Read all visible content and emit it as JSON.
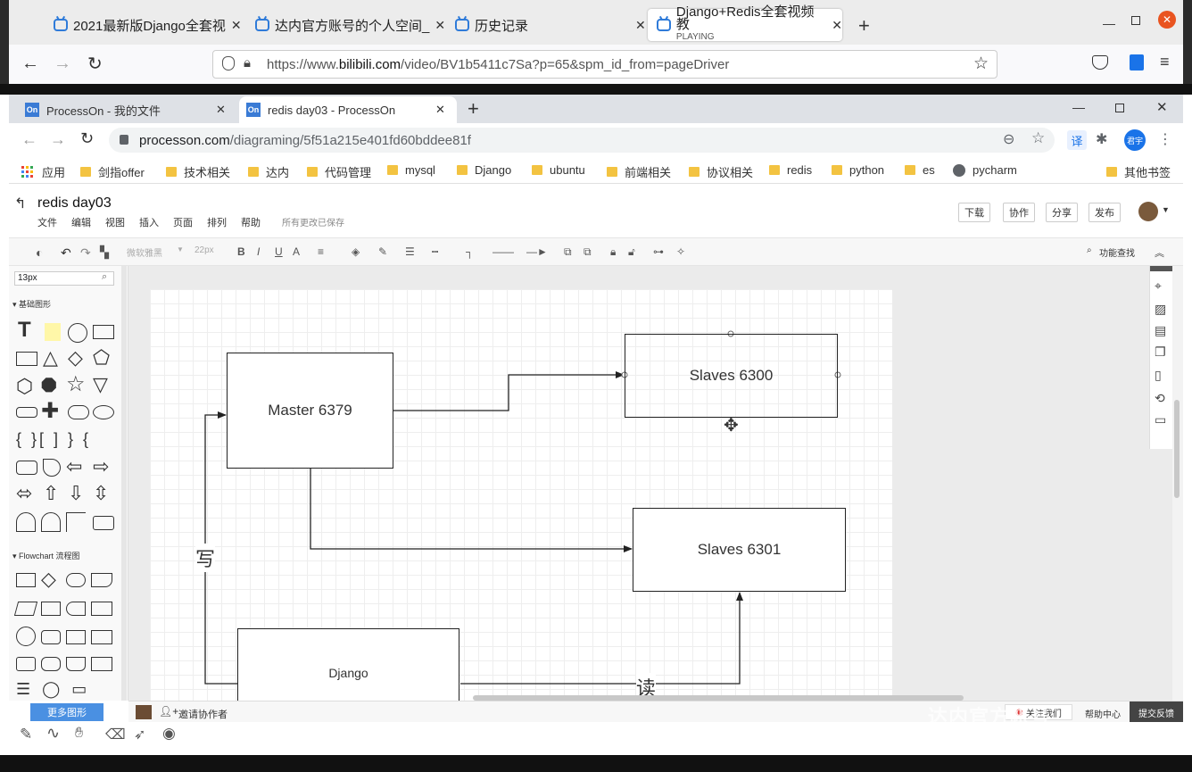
{
  "firefox": {
    "tabs": [
      {
        "title": "2021最新版Django全套视"
      },
      {
        "title": "达内官方账号的个人空间_"
      },
      {
        "title": "历史记录"
      },
      {
        "title": "Django+Redis全套视频教",
        "subtitle": "PLAYING"
      }
    ],
    "url_prefix": "https://www.",
    "url_host": "bilibili.com",
    "url_path": "/video/BV1b5411c7Sa?p=65&spm_id_from=pageDriver"
  },
  "chrome": {
    "tabs": [
      {
        "icon": "On",
        "title": "ProcessOn - 我的文件"
      },
      {
        "icon": "On",
        "title": "redis day03 - ProcessOn"
      }
    ],
    "url_host": "processon.com",
    "url_path": "/diagraming/5f51a215e401fd60bddee81f",
    "translate_label": "译",
    "profile_label": "君宇",
    "bookmarks": [
      "应用",
      "剑指offer",
      "技术相关",
      "达内",
      "代码管理",
      "mysql",
      "Django",
      "ubuntu",
      "前端相关",
      "协议相关",
      "redis",
      "python",
      "es",
      "pycharm",
      "其他书签"
    ]
  },
  "processon": {
    "doc_title": "redis day03",
    "menu": [
      "文件",
      "编辑",
      "视图",
      "插入",
      "页面",
      "排列",
      "帮助"
    ],
    "save_status": "所有更改已保存",
    "buttons": [
      "下载",
      "协作",
      "分享",
      "发布"
    ],
    "toolbar": {
      "font": "微软雅黑",
      "size": "22px",
      "search": "功能查找"
    },
    "search_value": "13px",
    "sections": {
      "basic": "基础图形",
      "flowchart": "Flowchart 流程图"
    },
    "more_shapes": "更多图形",
    "invite": "邀请协作者",
    "bottom_right": [
      "关注我们",
      "帮助中心",
      "提交反馈"
    ],
    "diagram": {
      "nodes": {
        "master": "Master 6379",
        "slave1": "Slaves 6300",
        "slave2": "Slaves 6301",
        "django": "Django"
      },
      "labels": {
        "write": "写",
        "read": "读"
      }
    }
  },
  "watermark": "达内官方帐号"
}
